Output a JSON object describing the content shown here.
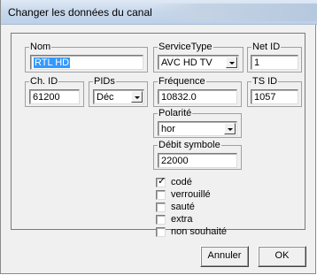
{
  "window": {
    "title": "Changer les données du canal"
  },
  "fields": {
    "nom": {
      "label": "Nom",
      "value": "RTL HD"
    },
    "service_type": {
      "label": "ServiceType",
      "value": "AVC HD TV"
    },
    "net_id": {
      "label": "Net ID",
      "value": "1"
    },
    "ch_id": {
      "label": "Ch. ID",
      "value": "61200"
    },
    "pids": {
      "label": "PIDs",
      "value": "Déc"
    },
    "frequence": {
      "label": "Fréquence",
      "value": "10832.0"
    },
    "ts_id": {
      "label": "TS ID",
      "value": "1057"
    },
    "polarite": {
      "label": "Polarité",
      "value": "hor"
    },
    "debit_symbole": {
      "label": "Débit symbole",
      "value": "22000"
    }
  },
  "checkboxes": [
    {
      "label": "codé",
      "checked": true
    },
    {
      "label": "verrouillé",
      "checked": false
    },
    {
      "label": "sauté",
      "checked": false
    },
    {
      "label": "extra",
      "checked": false
    },
    {
      "label": "non souhaité",
      "checked": false
    }
  ],
  "buttons": {
    "cancel": "Annuler",
    "ok": "OK"
  },
  "colors": {
    "selection": "#3399ff",
    "dialog_bg": "#f0f0f0"
  }
}
